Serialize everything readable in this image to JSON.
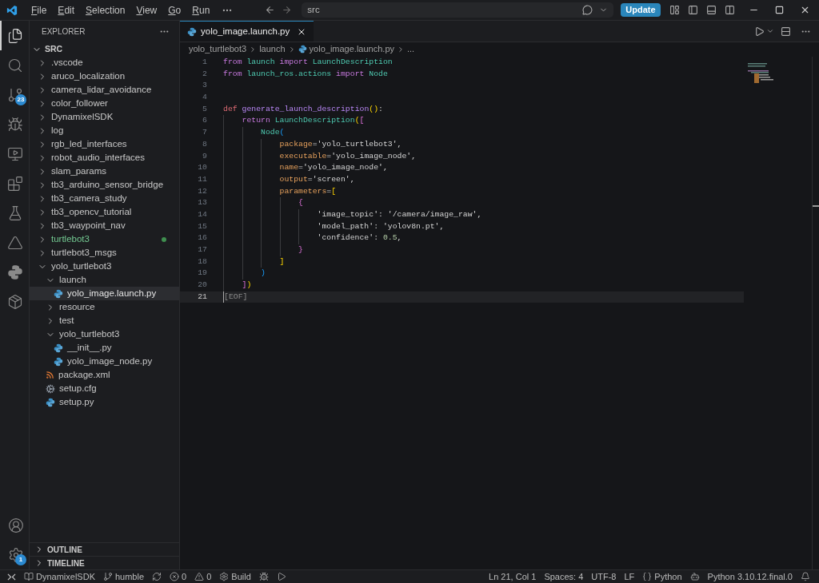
{
  "title_bar": {
    "menu": [
      "File",
      "Edit",
      "Selection",
      "View",
      "Go",
      "Run"
    ],
    "search": {
      "value": "src"
    },
    "update_button": "Update"
  },
  "activity_bar": [
    {
      "kind": "explorer",
      "selected": true
    },
    {
      "kind": "search",
      "selected": false
    },
    {
      "kind": "scm",
      "selected": false,
      "badge": "23"
    },
    {
      "kind": "debug",
      "selected": false
    },
    {
      "kind": "remote",
      "selected": false
    },
    {
      "kind": "extensions",
      "selected": false
    },
    {
      "kind": "testing",
      "selected": false
    },
    {
      "kind": "ros",
      "selected": false
    },
    {
      "kind": "python",
      "selected": false
    },
    {
      "kind": "containers",
      "selected": false
    }
  ],
  "activity_bottom": [
    {
      "kind": "accounts"
    },
    {
      "kind": "manage",
      "badge": "1"
    }
  ],
  "sidebar": {
    "title": "EXPLORER",
    "root": {
      "label": "SRC",
      "expanded": true
    },
    "tree": [
      {
        "label": ".vscode",
        "kind": "folder",
        "expanded": false,
        "selected": false,
        "modified": false
      },
      {
        "label": "aruco_localization",
        "kind": "folder",
        "expanded": false,
        "selected": false,
        "modified": false
      },
      {
        "label": "camera_lidar_avoidance",
        "kind": "folder",
        "expanded": false,
        "selected": false,
        "modified": false
      },
      {
        "label": "color_follower",
        "kind": "folder",
        "expanded": false,
        "selected": false,
        "modified": false
      },
      {
        "label": "DynamixelSDK",
        "kind": "folder",
        "expanded": false,
        "selected": false,
        "modified": false
      },
      {
        "label": "log",
        "kind": "folder",
        "expanded": false,
        "selected": false,
        "modified": false
      },
      {
        "label": "rgb_led_interfaces",
        "kind": "folder",
        "expanded": false,
        "selected": false,
        "modified": false
      },
      {
        "label": "robot_audio_interfaces",
        "kind": "folder",
        "expanded": false,
        "selected": false,
        "modified": false
      },
      {
        "label": "slam_params",
        "kind": "folder",
        "expanded": false,
        "selected": false,
        "modified": false
      },
      {
        "label": "tb3_arduino_sensor_bridge",
        "kind": "folder",
        "expanded": false,
        "selected": false,
        "modified": false
      },
      {
        "label": "tb3_camera_study",
        "kind": "folder",
        "expanded": false,
        "selected": false,
        "modified": false
      },
      {
        "label": "tb3_opencv_tutorial",
        "kind": "folder",
        "expanded": false,
        "selected": false,
        "modified": false
      },
      {
        "label": "tb3_waypoint_nav",
        "kind": "folder",
        "expanded": false,
        "selected": false,
        "modified": false
      },
      {
        "label": "turtlebot3",
        "kind": "folder",
        "expanded": false,
        "selected": false,
        "modified": true
      },
      {
        "label": "turtlebot3_msgs",
        "kind": "folder",
        "expanded": false,
        "selected": false,
        "modified": false
      },
      {
        "label": "yolo_turtlebot3",
        "kind": "folder",
        "expanded": true,
        "selected": false,
        "modified": false,
        "children": [
          {
            "label": "launch",
            "kind": "folder",
            "expanded": true,
            "selected": false,
            "modified": false,
            "children": [
              {
                "label": "yolo_image.launch.py",
                "kind": "python",
                "selected": true,
                "modified": false
              }
            ]
          },
          {
            "label": "resource",
            "kind": "folder",
            "expanded": false,
            "selected": false,
            "modified": false
          },
          {
            "label": "test",
            "kind": "folder",
            "expanded": false,
            "selected": false,
            "modified": false
          },
          {
            "label": "yolo_turtlebot3",
            "kind": "folder",
            "expanded": true,
            "selected": false,
            "modified": false,
            "children": [
              {
                "label": "__init__.py",
                "kind": "python",
                "selected": false,
                "modified": false
              },
              {
                "label": "yolo_image_node.py",
                "kind": "python",
                "selected": false,
                "modified": false
              }
            ]
          },
          {
            "label": "package.xml",
            "kind": "xml",
            "selected": false,
            "modified": false
          },
          {
            "label": "setup.cfg",
            "kind": "config",
            "selected": false,
            "modified": false
          },
          {
            "label": "setup.py",
            "kind": "python",
            "selected": false,
            "modified": false
          }
        ]
      }
    ],
    "sections": [
      {
        "label": "OUTLINE",
        "expanded": false
      },
      {
        "label": "TIMELINE",
        "expanded": false
      }
    ]
  },
  "tab": {
    "label": "yolo_image.launch.py",
    "selected": true
  },
  "breadcrumbs": [
    "yolo_turtlebot3",
    "launch",
    "yolo_image.launch.py",
    "..."
  ],
  "code": [
    {
      "number": "1",
      "current": false,
      "tokens": [
        {
          "text": "from ",
          "kind": "kw"
        },
        {
          "text": "launch ",
          "kind": "mod"
        },
        {
          "text": "import ",
          "kind": "kw"
        },
        {
          "text": "LaunchDescription",
          "kind": "cls"
        }
      ]
    },
    {
      "number": "2",
      "current": false,
      "tokens": [
        {
          "text": "from ",
          "kind": "kw"
        },
        {
          "text": "launch_ros.actions ",
          "kind": "mod"
        },
        {
          "text": "import ",
          "kind": "kw"
        },
        {
          "text": "Node",
          "kind": "cls"
        }
      ]
    },
    {
      "number": "3",
      "current": false
    },
    {
      "number": "4",
      "current": false
    },
    {
      "number": "5",
      "current": false,
      "tokens": [
        {
          "text": "def ",
          "kind": "def"
        },
        {
          "text": "generate_launch_description",
          "kind": "fn"
        },
        {
          "text": "()",
          "kind": "b1"
        },
        {
          "text": ":",
          "kind": "p"
        }
      ]
    },
    {
      "number": "6",
      "current": false,
      "tokens": [
        {
          "text": "    return ",
          "kind": "kw"
        },
        {
          "text": "LaunchDescription",
          "kind": "cls"
        },
        {
          "text": "(",
          "kind": "b1"
        },
        {
          "text": "[",
          "kind": "b2"
        }
      ]
    },
    {
      "number": "7",
      "current": false,
      "tokens": [
        {
          "text": "        Node",
          "kind": "cls"
        },
        {
          "text": "(",
          "kind": "b3"
        }
      ]
    },
    {
      "number": "8",
      "current": false,
      "tokens": [
        {
          "text": "            package",
          "kind": "param"
        },
        {
          "text": "=",
          "kind": "p"
        },
        {
          "text": "'yolo_turtlebot3'",
          "kind": "str"
        },
        {
          "text": ",",
          "kind": "p"
        }
      ]
    },
    {
      "number": "9",
      "current": false,
      "tokens": [
        {
          "text": "            executable",
          "kind": "param"
        },
        {
          "text": "=",
          "kind": "p"
        },
        {
          "text": "'yolo_image_node'",
          "kind": "str"
        },
        {
          "text": ",",
          "kind": "p"
        }
      ]
    },
    {
      "number": "10",
      "current": false,
      "tokens": [
        {
          "text": "            name",
          "kind": "param"
        },
        {
          "text": "=",
          "kind": "p"
        },
        {
          "text": "'yolo_image_node'",
          "kind": "str"
        },
        {
          "text": ",",
          "kind": "p"
        }
      ]
    },
    {
      "number": "11",
      "current": false,
      "tokens": [
        {
          "text": "            output",
          "kind": "param"
        },
        {
          "text": "=",
          "kind": "p"
        },
        {
          "text": "'screen'",
          "kind": "str"
        },
        {
          "text": ",",
          "kind": "p"
        }
      ]
    },
    {
      "number": "12",
      "current": false,
      "tokens": [
        {
          "text": "            parameters",
          "kind": "param"
        },
        {
          "text": "=",
          "kind": "p"
        },
        {
          "text": "[",
          "kind": "b1"
        }
      ]
    },
    {
      "number": "13",
      "current": false,
      "tokens": [
        {
          "text": "                {",
          "kind": "b2"
        }
      ]
    },
    {
      "number": "14",
      "current": false,
      "tokens": [
        {
          "text": "                    'image_topic'",
          "kind": "str"
        },
        {
          "text": ": ",
          "kind": "p"
        },
        {
          "text": "'/camera/image_raw'",
          "kind": "str"
        },
        {
          "text": ",",
          "kind": "p"
        }
      ]
    },
    {
      "number": "15",
      "current": false,
      "tokens": [
        {
          "text": "                    'model_path'",
          "kind": "str"
        },
        {
          "text": ": ",
          "kind": "p"
        },
        {
          "text": "'yolov8n.pt'",
          "kind": "str"
        },
        {
          "text": ",",
          "kind": "p"
        }
      ]
    },
    {
      "number": "16",
      "current": false,
      "tokens": [
        {
          "text": "                    'confidence'",
          "kind": "str"
        },
        {
          "text": ": ",
          "kind": "p"
        },
        {
          "text": "0.5",
          "kind": "num"
        },
        {
          "text": ",",
          "kind": "p"
        }
      ]
    },
    {
      "number": "17",
      "current": false,
      "tokens": [
        {
          "text": "                }",
          "kind": "b2"
        }
      ]
    },
    {
      "number": "18",
      "current": false,
      "tokens": [
        {
          "text": "            ]",
          "kind": "b1"
        }
      ]
    },
    {
      "number": "19",
      "current": false,
      "tokens": [
        {
          "text": "        )",
          "kind": "b3"
        }
      ]
    },
    {
      "number": "20",
      "current": false,
      "tokens": [
        {
          "text": "    ]",
          "kind": "b2"
        },
        {
          "text": ")",
          "kind": "b1"
        }
      ]
    },
    {
      "number": "21",
      "current": true,
      "tokens": [
        {
          "text": "[EOF]",
          "kind": "eof"
        }
      ]
    }
  ],
  "status_bar": {
    "left": [
      {
        "kind": "remote"
      },
      {
        "kind": "folder",
        "text": "DynamixelSDK"
      },
      {
        "kind": "branch",
        "text": "humble"
      },
      {
        "kind": "sync"
      },
      {
        "kind": "errors",
        "text": "0"
      },
      {
        "kind": "warnings",
        "text": "0"
      },
      {
        "kind": "build",
        "text": "Build"
      },
      {
        "kind": "debug"
      },
      {
        "kind": "run"
      }
    ],
    "right": [
      {
        "kind": "text",
        "text": "Ln 21, Col 1"
      },
      {
        "kind": "text",
        "text": "Spaces: 4"
      },
      {
        "kind": "text",
        "text": "UTF-8"
      },
      {
        "kind": "text",
        "text": "LF"
      },
      {
        "kind": "language",
        "text": "Python"
      },
      {
        "kind": "copilot"
      },
      {
        "kind": "text",
        "text": "Python 3.10.12.final.0"
      },
      {
        "kind": "bell"
      }
    ]
  }
}
